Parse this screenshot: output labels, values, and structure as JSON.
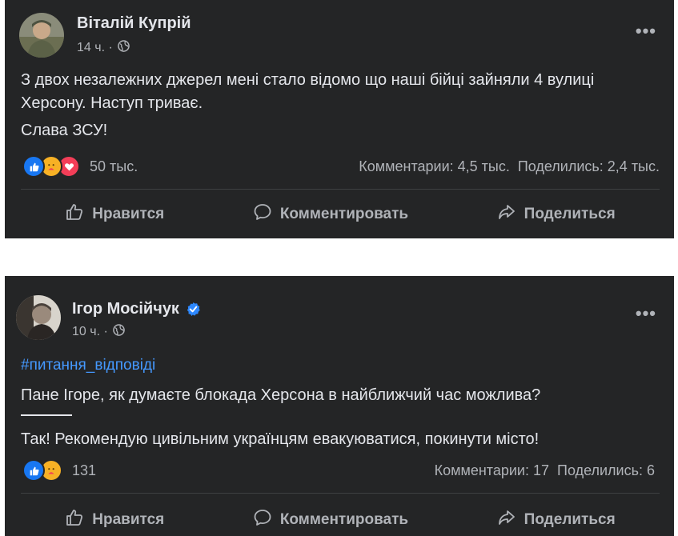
{
  "posts": [
    {
      "author": "Віталій Купрій",
      "time": "14 ч. ·",
      "verified": false,
      "body_lines": [
        "З двох незалежних джерел мені стало відомо що наші бійці зайняли 4 вулиці Херсону. Наступ триває.",
        "Слава ЗСУ!"
      ],
      "reactions": [
        "like-icon",
        "care-icon",
        "love-icon"
      ],
      "reaction_count": "50 тыс.",
      "comments": "Комментарии: 4,5 тыс.",
      "shares": "Поделились: 2,4 тыс."
    },
    {
      "author": "Ігор Мосійчук",
      "time": "10 ч. ·",
      "verified": true,
      "hashtag": "#питання_відповіді",
      "question": "Пане Ігоре, як думаєте блокада Херсона в найближчий час можлива?",
      "answer": "Так! Рекомендую цивільним українцям евакуюватися, покинути місто!",
      "reactions": [
        "like-icon",
        "care-icon"
      ],
      "reaction_count": "131",
      "comments": "Комментарии: 17",
      "shares": "Поделились: 6"
    }
  ],
  "actions": {
    "like": "Нравится",
    "comment": "Комментировать",
    "share": "Поделиться"
  },
  "more_label": "•••",
  "colors": {
    "card": "#242526",
    "text": "#e4e6eb",
    "muted": "#b0b3b8",
    "link": "#4599ff",
    "like": "#1877f2",
    "love": "#f33e58",
    "care": "#f7b125"
  }
}
